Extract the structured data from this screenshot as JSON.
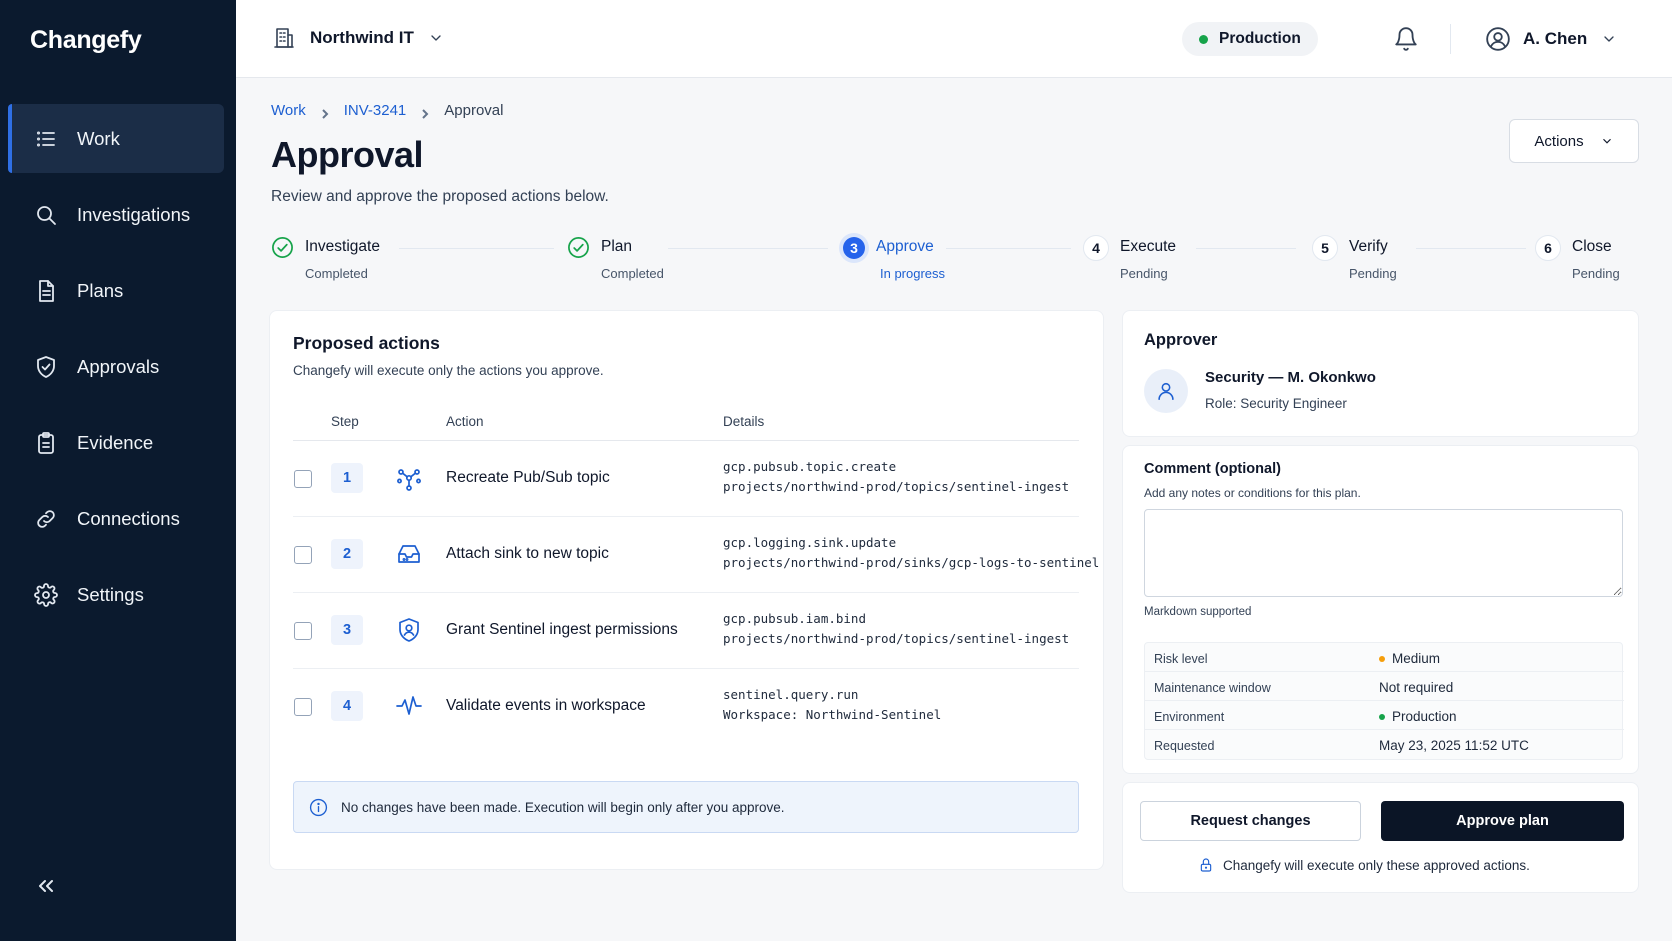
{
  "brand": "Changefy",
  "sidebar": {
    "items": [
      {
        "label": "Work",
        "icon": "list-icon",
        "active": true
      },
      {
        "label": "Investigations",
        "icon": "search-icon"
      },
      {
        "label": "Plans",
        "icon": "document-icon"
      },
      {
        "label": "Approvals",
        "icon": "shield-check-icon"
      },
      {
        "label": "Evidence",
        "icon": "clipboard-icon"
      },
      {
        "label": "Connections",
        "icon": "link-icon"
      },
      {
        "label": "Settings",
        "icon": "gear-icon"
      }
    ],
    "collapse_icon": "double-chevron-left-icon"
  },
  "topbar": {
    "org": "Northwind IT",
    "environment": "Production",
    "environment_color": "#16a34a",
    "user": "A. Chen"
  },
  "breadcrumb": {
    "items": [
      "Work",
      "INV-3241"
    ],
    "current": "Approval"
  },
  "page": {
    "title": "Approval",
    "subtitle": "Review and approve the proposed actions below.",
    "actions_label": "Actions"
  },
  "stepper": [
    {
      "label": "Investigate",
      "status": "Completed",
      "state": "done"
    },
    {
      "label": "Plan",
      "status": "Completed",
      "state": "done"
    },
    {
      "num": "3",
      "label": "Approve",
      "status": "In progress",
      "state": "current"
    },
    {
      "num": "4",
      "label": "Execute",
      "status": "Pending",
      "state": "pending"
    },
    {
      "num": "5",
      "label": "Verify",
      "status": "Pending",
      "state": "pending"
    },
    {
      "num": "6",
      "label": "Close",
      "status": "Pending",
      "state": "pending"
    }
  ],
  "proposed": {
    "title": "Proposed actions",
    "subtitle": "Changefy will execute only the actions you approve.",
    "columns": [
      "Step",
      "Action",
      "Details"
    ],
    "rows": [
      {
        "step": "1",
        "icon": "pubsub-icon",
        "action": "Recreate Pub/Sub topic",
        "detail1": "gcp.pubsub.topic.create",
        "detail2": "projects/northwind-prod/topics/sentinel-ingest"
      },
      {
        "step": "2",
        "icon": "inbox-icon",
        "action": "Attach sink to new topic",
        "detail1": "gcp.logging.sink.update",
        "detail2": "projects/northwind-prod/sinks/gcp-logs-to-sentinel"
      },
      {
        "step": "3",
        "icon": "shield-user-icon",
        "action": "Grant Sentinel ingest permissions",
        "detail1": "gcp.pubsub.iam.bind",
        "detail2": "projects/northwind-prod/topics/sentinel-ingest"
      },
      {
        "step": "4",
        "icon": "pulse-icon",
        "action": "Validate events in workspace",
        "detail1": "sentinel.query.run",
        "detail2": "Workspace: Northwind-Sentinel"
      }
    ],
    "info": "No changes have been made. Execution will begin only after you approve."
  },
  "approver": {
    "title": "Approver",
    "name": "Security — M. Okonkwo",
    "role": "Role: Security Engineer"
  },
  "comment": {
    "label": "Comment (optional)",
    "hint": "Add any notes or conditions for this plan.",
    "value": "",
    "markdown_note": "Markdown supported"
  },
  "meta": [
    {
      "key": "Risk level",
      "value": "Medium",
      "dot": "#f59e0b"
    },
    {
      "key": "Maintenance window",
      "value": "Not required"
    },
    {
      "key": "Environment",
      "value": "Production",
      "dot": "#16a34a"
    },
    {
      "key": "Requested",
      "value": "May 23, 2025 11:52 UTC"
    }
  ],
  "decision": {
    "request_changes": "Request changes",
    "approve": "Approve plan",
    "note": "Changefy will execute only these approved actions."
  }
}
